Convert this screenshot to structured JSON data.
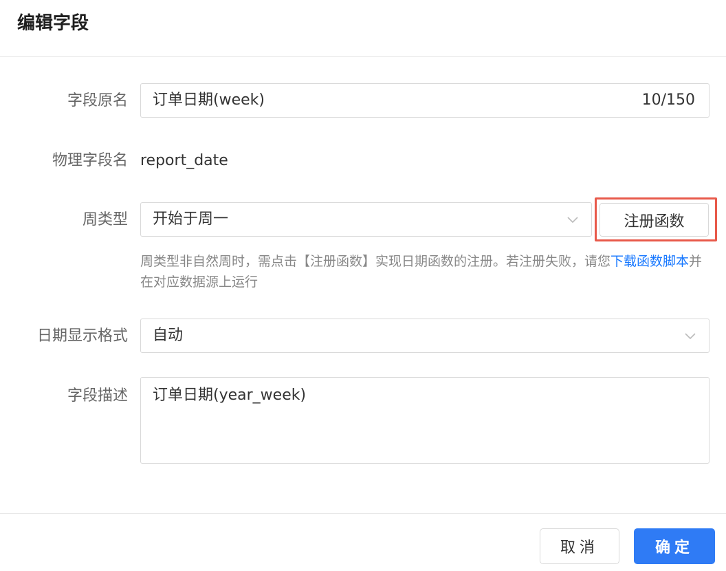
{
  "dialog": {
    "title": "编辑字段",
    "fields": {
      "original_name": {
        "label": "字段原名",
        "value": "订单日期(week)",
        "counter": "10/150"
      },
      "physical_name": {
        "label": "物理字段名",
        "value": "report_date"
      },
      "week_type": {
        "label": "周类型",
        "value": "开始于周一",
        "register_button": "注册函数",
        "hint_prefix": "周类型非自然周时，需点击【注册函数】实现日期函数的注册。若注册失败，请您",
        "hint_link": "下载函数脚本",
        "hint_suffix": "并在对应数据源上运行"
      },
      "date_format": {
        "label": "日期显示格式",
        "value": "自动"
      },
      "description": {
        "label": "字段描述",
        "value": "订单日期(year_week)"
      }
    },
    "footer": {
      "cancel_label": "取消",
      "ok_label": "确定"
    }
  },
  "colors": {
    "primary": "#2f7bf5",
    "link": "#1677ff",
    "highlight": "#e8594a"
  },
  "icons": {
    "select_arrow": "chevron-down-icon"
  }
}
